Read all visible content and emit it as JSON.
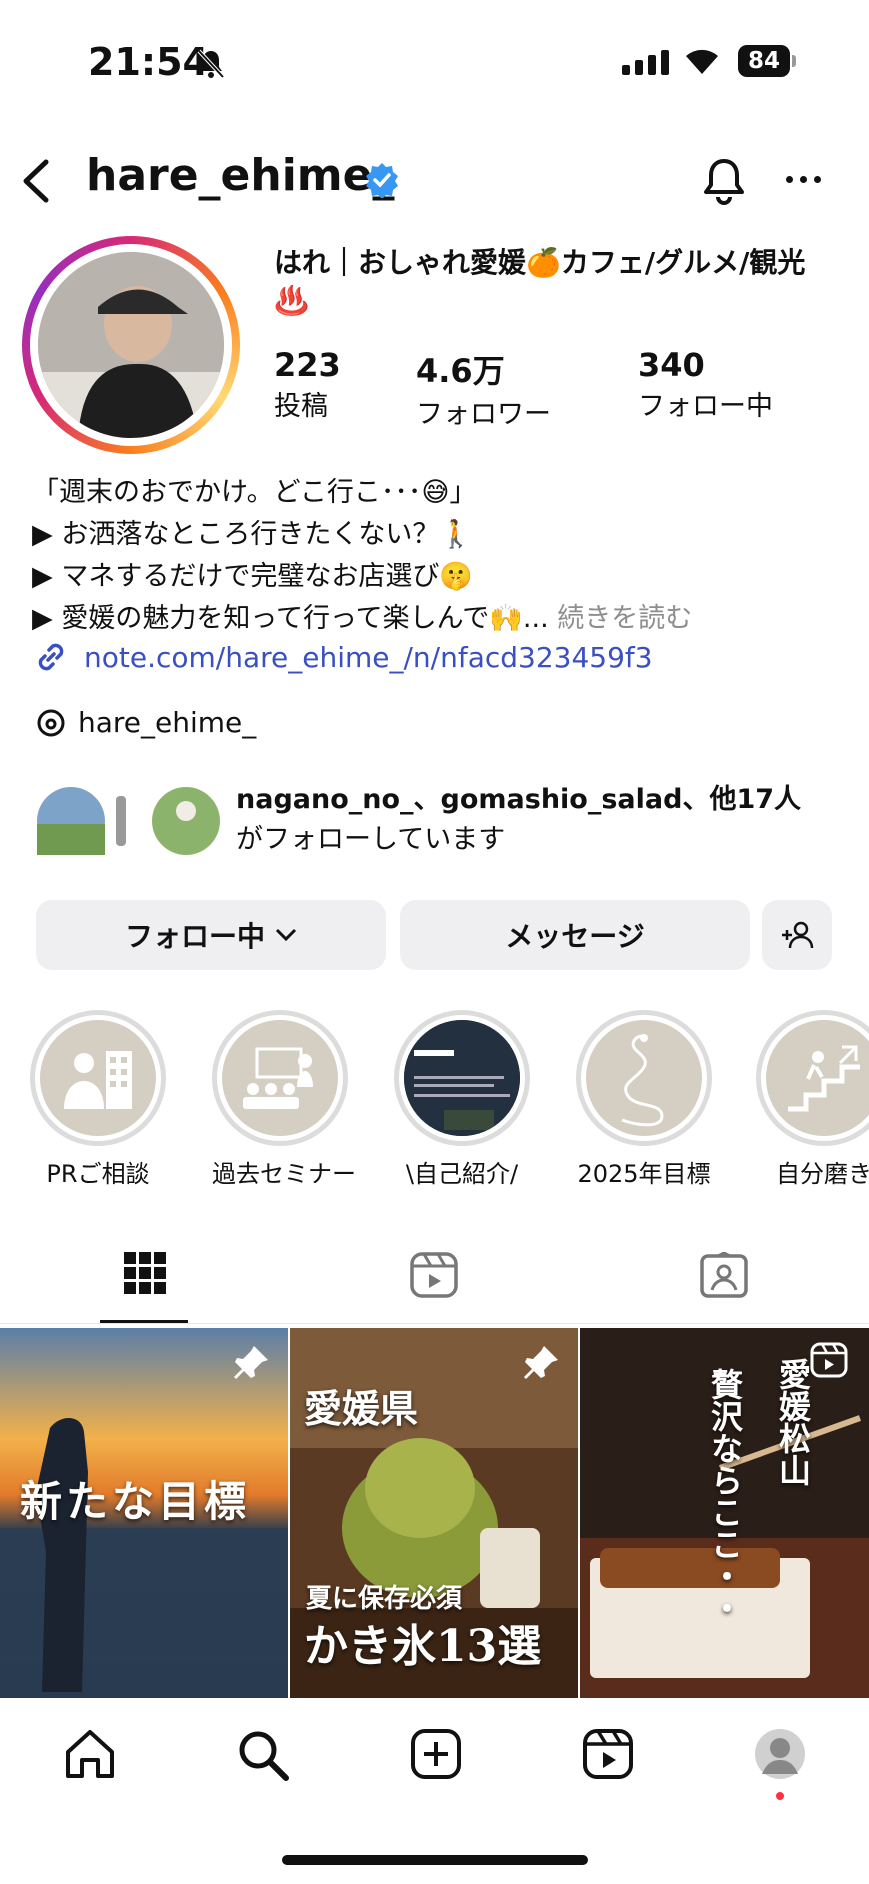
{
  "status_bar": {
    "time": "21:54",
    "battery": "84"
  },
  "header": {
    "username": "hare_ehime_"
  },
  "profile": {
    "display_name": "はれ｜おしゃれ愛媛🍊カフェ/グルメ/観光♨️",
    "stats": [
      {
        "value": "223",
        "label": "投稿"
      },
      {
        "value": "4.6万",
        "label": "フォロワー"
      },
      {
        "value": "340",
        "label": "フォロー中"
      }
    ],
    "bio": [
      "「週末のおでかけ。どこ行こ･･･😅」",
      "▶ お洒落なところ行きたくない？🚶",
      "▶ マネするだけで完璧なお店選び🤫",
      "▶ 愛媛の魅力を知って行って楽しんで🙌..."
    ],
    "bio_more": "続きを読む",
    "link": "note.com/hare_ehime_/n/nfacd323459f3",
    "threads": "hare_ehime_",
    "mutual_names": "nagano_no_、gomashio_salad、他17人",
    "mutual_suffix": "がフォローしています"
  },
  "buttons": {
    "following": "フォロー中",
    "message": "メッセージ"
  },
  "highlights": [
    {
      "label": "PRご相談",
      "icon": "business-person-icon"
    },
    {
      "label": "過去セミナー",
      "icon": "seminar-icon"
    },
    {
      "label": "\\自己紹介/",
      "icon": "intro-image"
    },
    {
      "label": "2025年目標",
      "icon": "snake-icon"
    },
    {
      "label": "自分磨き",
      "icon": "stairs-climb-icon"
    }
  ],
  "tabs": [
    {
      "icon": "grid-icon"
    },
    {
      "icon": "reels-icon"
    },
    {
      "icon": "tagged-icon"
    }
  ],
  "posts": [
    {
      "text": "新たな目標",
      "pinned": true
    },
    {
      "text_top": "愛媛県",
      "text_sub": "夏に保存必須",
      "text_main": "かき氷13選",
      "pinned": true
    },
    {
      "text_1": "愛媛松山",
      "text_2": "贅沢ならここ・・",
      "reel": true
    }
  ],
  "bottom_nav": [
    "home-icon",
    "search-icon",
    "create-icon",
    "reels-icon",
    "profile-avatar"
  ],
  "colors": {
    "link": "#3a4fc1",
    "verified": "#3897f0",
    "button_bg": "#efeff1"
  }
}
